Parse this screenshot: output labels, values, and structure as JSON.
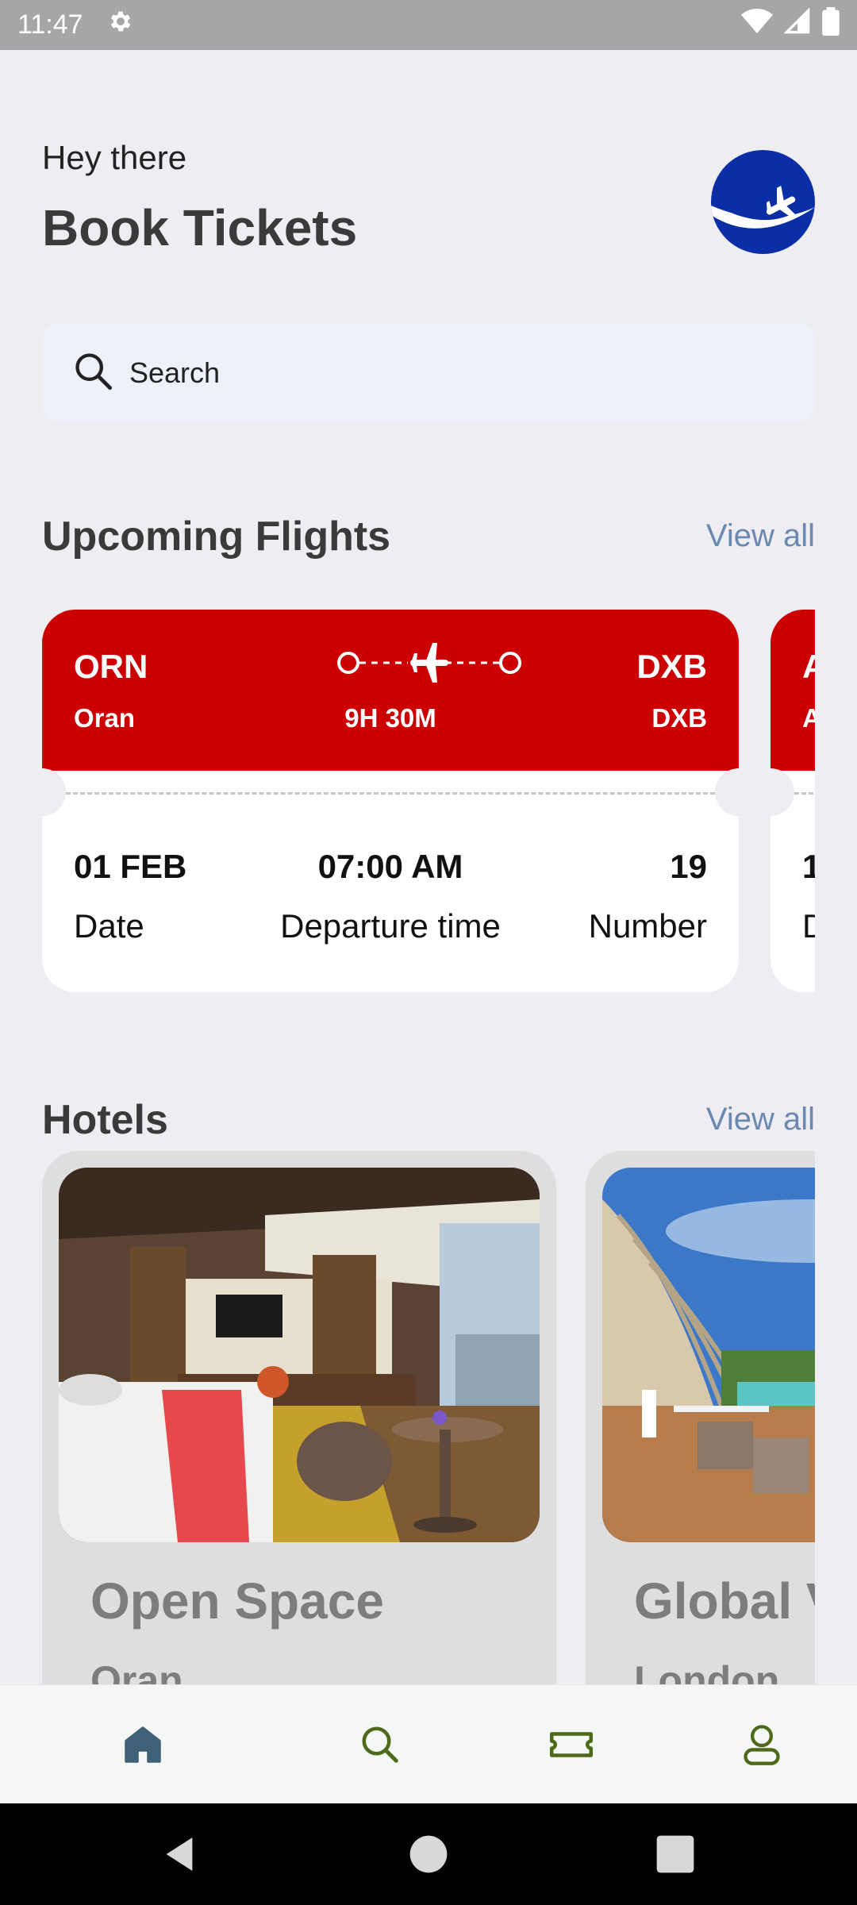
{
  "status_bar": {
    "time": "11:47"
  },
  "header": {
    "greeting": "Hey there",
    "title": "Book Tickets"
  },
  "search": {
    "label": "Search"
  },
  "sections": {
    "flights": {
      "title": "Upcoming Flights",
      "view_all": "View all"
    },
    "hotels": {
      "title": "Hotels",
      "view_all": "View all"
    }
  },
  "flights": [
    {
      "from_code": "ORN",
      "from_city": "Oran",
      "to_code": "DXB",
      "to_city": "DXB",
      "duration": "9H 30M",
      "date": "01 FEB",
      "date_label": "Date",
      "departure": "07:00 AM",
      "departure_label": "Departure time",
      "number": "19",
      "number_label": "Number"
    },
    {
      "from_code": "A",
      "from_city": "A",
      "date": "1",
      "date_label": "D"
    }
  ],
  "hotels": [
    {
      "name": "Open Space",
      "city": "Oran"
    },
    {
      "name": "Global V",
      "city": "London"
    }
  ],
  "colors": {
    "flight_header": "#cc0000",
    "brand_blue": "#0a2ea5",
    "link": "#6a88b0",
    "nav_active": "#3f6178",
    "nav_inactive": "#4d6a1a"
  },
  "bottom_nav": {
    "items": [
      {
        "icon": "home-icon",
        "active": true
      },
      {
        "icon": "search-icon",
        "active": false
      },
      {
        "icon": "ticket-icon",
        "active": false
      },
      {
        "icon": "profile-icon",
        "active": false
      }
    ]
  }
}
